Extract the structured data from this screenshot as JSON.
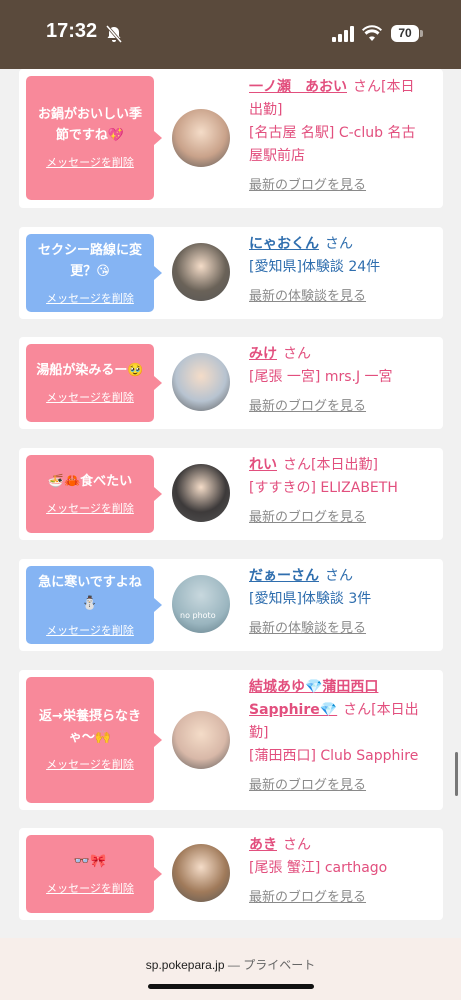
{
  "status_bar": {
    "time": "17:32",
    "battery": "70"
  },
  "delete_label": "メッセージを削除",
  "san": "さん",
  "cards": [
    {
      "bubble": [
        "お鍋がおいしい季",
        "節ですね💖"
      ],
      "bubble_color": "pink",
      "name": "一ノ瀬　あおい",
      "name_color": "pink",
      "suffix": "[本日",
      "lines": [
        "出勤]",
        "[名古屋 名駅] C-club 名古",
        "屋駅前店"
      ],
      "link": "最新のブログを見る",
      "avatar": "#c9a28a"
    },
    {
      "bubble": [
        "セクシー路線に変",
        "更？😘"
      ],
      "bubble_color": "blue",
      "name": "にゃおくん",
      "name_color": "blue",
      "suffix": "",
      "lines": [
        "[愛知県]体験談 24件"
      ],
      "link": "最新の体験談を見る",
      "avatar": "#6a6258"
    },
    {
      "bubble": [
        "湯船が染みるー🥹"
      ],
      "bubble_color": "pink",
      "name": "みけ",
      "name_color": "pink",
      "suffix": "",
      "lines": [
        "[尾張 一宮] mrs.J 一宮"
      ],
      "link": "最新のブログを見る",
      "avatar": "#b7c3d0"
    },
    {
      "bubble": [
        "🍜🦀食べたい"
      ],
      "bubble_color": "pink",
      "name": "れい",
      "name_color": "pink",
      "suffix": "[本日出勤]",
      "lines": [
        "[すすきの] ELIZABETH"
      ],
      "link": "最新のブログを見る",
      "avatar": "#3d3a3a"
    },
    {
      "bubble": [
        "急に寒いですよね",
        "⛄"
      ],
      "bubble_color": "blue",
      "name": "だぁーさん",
      "name_color": "blue",
      "suffix": "",
      "lines": [
        "[愛知県]体験談 3件"
      ],
      "link": "最新の体験談を見る",
      "avatar": "#9ab5bf",
      "avatar_text": "no photo"
    },
    {
      "bubble": [
        "返→栄養摂らなき",
        "ゃ〜🙌"
      ],
      "bubble_color": "pink",
      "name": "結城あゆ💎蒲田西口",
      "name2": "Sapphire💎",
      "name_color": "pink",
      "suffix": "[本日出",
      "lines": [
        "勤]",
        "[蒲田西口] Club Sapphire"
      ],
      "link": "最新のブログを見る",
      "avatar": "#d8b8a8"
    },
    {
      "bubble": [
        "👓🎀"
      ],
      "bubble_color": "pink",
      "name": "あき",
      "name_color": "pink",
      "suffix": "",
      "lines": [
        "[尾張 蟹江] carthago"
      ],
      "link": "最新のブログを見る",
      "avatar": "#a07a5a"
    }
  ],
  "bottom_bar": {
    "url": "sp.pokepara.jp",
    "private_label": "— プライベート"
  }
}
